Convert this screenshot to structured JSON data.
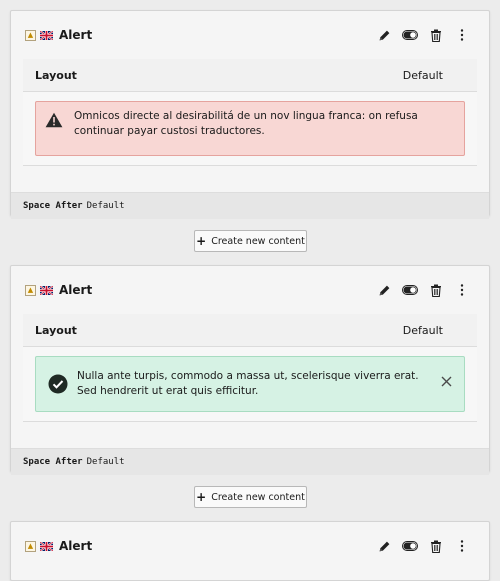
{
  "cards": [
    {
      "title": "Alert",
      "layout_label": "Layout",
      "layout_value": "Default",
      "alert_type": "danger",
      "alert_text": "Omnicos directe al desirabilitá de un nov lingua franca: on refusa continuar payar custosi traductores.",
      "footer_label": "Space After",
      "footer_value": "Default"
    },
    {
      "title": "Alert",
      "layout_label": "Layout",
      "layout_value": "Default",
      "alert_type": "success",
      "alert_text": "Nulla ante turpis, commodo a massa ut, scelerisque viverra erat. Sed hendrerit ut erat quis efficitur.",
      "footer_label": "Space After",
      "footer_value": "Default"
    },
    {
      "title": "Alert"
    }
  ],
  "create_button_label": "Create new content",
  "icons": {
    "type": "content-type-icon",
    "language": "uk-flag-icon",
    "edit": "pencil-icon",
    "toggle": "toggle-icon",
    "delete": "trash-icon",
    "more": "more-vertical-icon",
    "danger": "warning-triangle-icon",
    "success": "check-circle-icon",
    "close": "close-icon"
  },
  "colors": {
    "danger_bg": "#f8d7d4",
    "success_bg": "#d6f2e4"
  }
}
